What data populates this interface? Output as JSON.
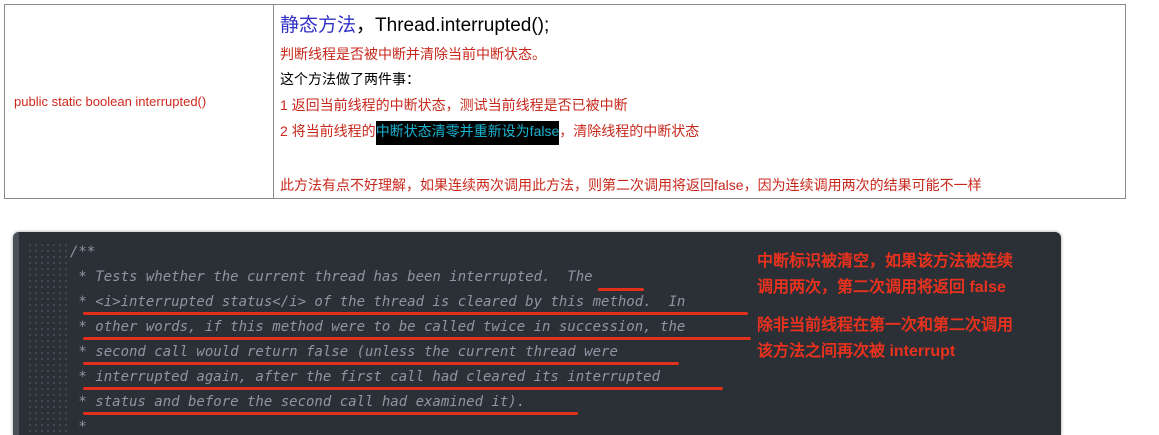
{
  "table": {
    "signature": "public static boolean interrupted()",
    "title_cn": "静态方法",
    "title_sep": "，",
    "title_code": "Thread.interrupted();",
    "line1": "判断线程是否被中断并清除当前中断状态。",
    "line2": "这个方法做了两件事：",
    "line3": "1 返回当前线程的中断状态，测试当前线程是否已被中断",
    "line4_prefix": "2 将当前线程的",
    "line4_highlight": "中断状态清零并重新设为false",
    "line4_suffix": "，清除线程的中断状态",
    "line5": "此方法有点不好理解，如果连续两次调用此方法，则第二次调用将返回false，因为连续调用两次的结果可能不一样"
  },
  "code": {
    "lines": [
      "/**",
      " * Tests whether the current thread has been interrupted.  The",
      " * <i>interrupted status</i> of the thread is cleared by this method.  In",
      " * other words, if this method were to be called twice in succession, the",
      " * second call would return false (unless the current thread were",
      " * interrupted again, after the first call had cleared its interrupted",
      " * status and before the second call had examined it).",
      " *"
    ]
  },
  "annotations": {
    "note1_line1": "中断标识被清空，如果该方法被连续",
    "note1_line2": "调用两次，第二次调用将返回 false",
    "note2_line1": "除非当前线程在第一次和第二次调用",
    "note2_line2": "该方法之间再次被 interrupt"
  },
  "colors": {
    "annotation_red": "#e8321e",
    "code_background": "#2b2f36",
    "highlight_text": "#19b4d2"
  }
}
